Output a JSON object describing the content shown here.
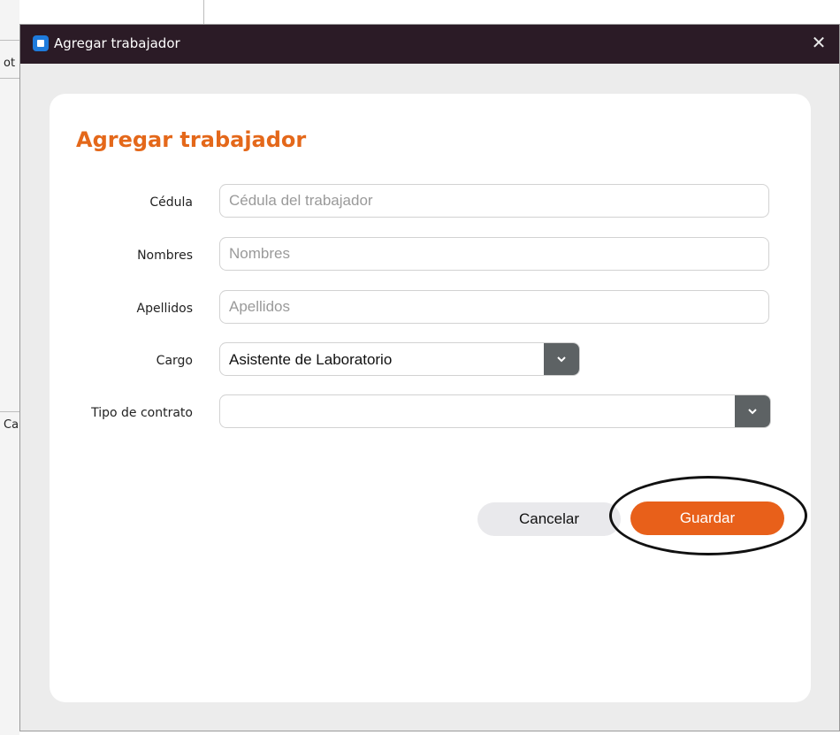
{
  "window": {
    "title": "Agregar trabajador",
    "close_glyph": "✕"
  },
  "background": {
    "frag_top": "ot",
    "frag_mid": "Ca"
  },
  "form": {
    "heading": "Agregar trabajador",
    "fields": {
      "cedula": {
        "label": "Cédula",
        "placeholder": "Cédula del trabajador",
        "value": ""
      },
      "nombres": {
        "label": "Nombres",
        "placeholder": "Nombres",
        "value": ""
      },
      "apellidos": {
        "label": "Apellidos",
        "placeholder": "Apellidos",
        "value": ""
      },
      "cargo": {
        "label": "Cargo",
        "selected": "Asistente de Laboratorio"
      },
      "tipo_contrato": {
        "label": "Tipo de contrato",
        "selected": ""
      }
    }
  },
  "buttons": {
    "cancel": "Cancelar",
    "save": "Guardar"
  },
  "colors": {
    "accent": "#e4681a",
    "titlebar": "#2b1b26",
    "select_arrow": "#5d6264"
  },
  "icons": {
    "app": "app-icon",
    "close": "close-icon",
    "dropdown": "chevron-down-icon"
  }
}
